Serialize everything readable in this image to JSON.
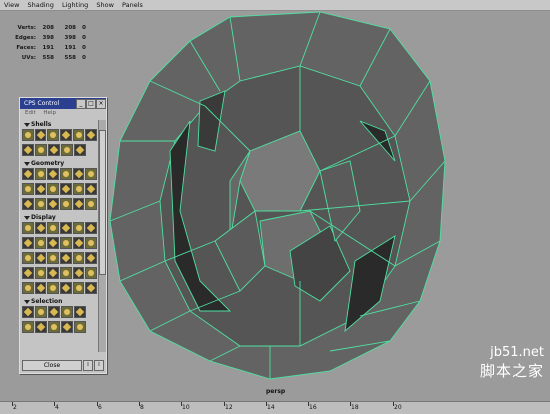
{
  "menu": [
    "View",
    "Shading",
    "Lighting",
    "Show",
    "Panels"
  ],
  "hud": [
    {
      "label": "Verts:",
      "a": "208",
      "b": "208",
      "c": "0"
    },
    {
      "label": "Edges:",
      "a": "398",
      "b": "398",
      "c": "0"
    },
    {
      "label": "Faces:",
      "a": "191",
      "b": "191",
      "c": "0"
    },
    {
      "label": "UVs:",
      "a": "558",
      "b": "558",
      "c": "0"
    }
  ],
  "viewport_label": "persp",
  "cps": {
    "title": "CPS Control",
    "menu": [
      "Edit",
      "Help"
    ],
    "sections": [
      "Shells",
      "Geometry",
      "Display",
      "Selection"
    ],
    "close": "Close",
    "btn_a": "I",
    "btn_b": "I"
  },
  "timeline": [
    "2",
    "4",
    "6",
    "8",
    "10",
    "12",
    "14",
    "16",
    "18",
    "20"
  ],
  "watermark": {
    "line1": "jb51.net",
    "line2": "脚本之家"
  }
}
